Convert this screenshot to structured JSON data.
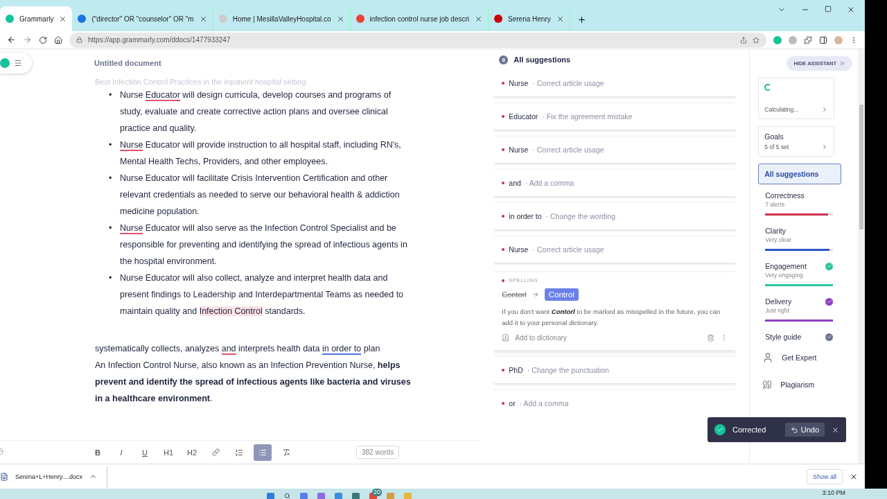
{
  "browser": {
    "tabs": [
      {
        "title": "Grammarly",
        "selected": true
      },
      {
        "title": "(\"director\" OR \"counselor\" OR \"m",
        "selected": false
      },
      {
        "title": "Home | MesillaValleyHospital.co",
        "selected": false
      },
      {
        "title": "infection control nurse job descri",
        "selected": false
      },
      {
        "title": "Serena Henry",
        "selected": false
      }
    ],
    "url": "https://app.grammarly.com/ddocs/1477933247"
  },
  "document": {
    "title": "Untitled document",
    "blocks": [
      {
        "kind": "faded",
        "segments": [
          {
            "text": "Best Infection Control Practices in the inpatient hospital setting.",
            "kind": "plain"
          }
        ]
      },
      {
        "kind": "bullet",
        "marker": "•",
        "segments": [
          {
            "text": "Nurse ",
            "kind": "plain"
          },
          {
            "text": "Educator",
            "kind": "error"
          },
          {
            "text": " will design curricula, develop courses and programs of study, evaluate and create corrective action plans and oversee clinical practice and quality.",
            "kind": "plain"
          }
        ]
      },
      {
        "kind": "bullet",
        "marker": "•",
        "segments": [
          {
            "text": "Nurse",
            "kind": "error"
          },
          {
            "text": " Educator will provide instruction to all hospital staff, including RN's, Mental Health Techs, Providers, and other employees.",
            "kind": "plain"
          }
        ]
      },
      {
        "kind": "bullet",
        "marker": "•",
        "segments": [
          {
            "text": "Nurse Educator will facilitate Crisis Intervention Certification and other relevant credentials as needed to serve our behavioral health & addiction medicine population.",
            "kind": "plain"
          }
        ]
      },
      {
        "kind": "bullet",
        "marker": "•",
        "segments": [
          {
            "text": "Nurse",
            "kind": "error"
          },
          {
            "text": " Educator will also serve as the Infection Control Specialist and be responsible for preventing and identifying the spread of infectious agents in the hospital environment.",
            "kind": "plain"
          }
        ]
      },
      {
        "kind": "bullet",
        "marker": "•",
        "segments": [
          {
            "text": "Nurse Educator will also collect, analyze and interpret health data and present findings to Leadership and Interdepartmental Teams as needed to maintain quality and ",
            "kind": "plain"
          },
          {
            "text": "Infection Control",
            "kind": "focus"
          },
          {
            "text": " standards.",
            "kind": "plain"
          }
        ]
      },
      {
        "kind": "paragraph",
        "segments": [
          {
            "text": "systematically collects, analyzes ",
            "kind": "plain"
          },
          {
            "text": "and",
            "kind": "error"
          },
          {
            "text": " interprets health data ",
            "kind": "plain"
          },
          {
            "text": "in order to",
            "kind": "clarity"
          },
          {
            "text": " plan",
            "kind": "plain"
          }
        ]
      },
      {
        "kind": "paragraph",
        "segments": [
          {
            "text": "An Infection Control Nurse, also known as an Infection Prevention Nurse, **helps prevent and identify the spread of infectious agents like bacteria and viruses in a healthcare environment**.",
            "kind": "plain"
          }
        ]
      }
    ],
    "toolbar": [
      {
        "kind": "bold",
        "label": "B",
        "selected": false
      },
      {
        "kind": "italic",
        "label": "I",
        "selected": false
      },
      {
        "kind": "underline",
        "label": "U",
        "selected": false
      },
      {
        "kind": "h1",
        "label": "H1",
        "selected": false
      },
      {
        "kind": "h2",
        "label": "H2",
        "selected": false
      },
      {
        "kind": "link",
        "selected": false
      },
      {
        "kind": "ordered",
        "selected": false
      },
      {
        "kind": "bullets",
        "selected": true
      },
      {
        "kind": "clear",
        "selected": false
      }
    ],
    "word_count": "382 words"
  },
  "suggestions": {
    "count": "8",
    "title": "All suggestions",
    "items": [
      {
        "kind": "short",
        "word": "Nurse",
        "hint": "· Correct article usage"
      },
      {
        "kind": "short",
        "word": "Educator",
        "hint": "· Fix the agreement mistake"
      },
      {
        "kind": "short",
        "word": "Nurse",
        "hint": "· Correct article usage"
      },
      {
        "kind": "short",
        "word": "and",
        "hint": "· Add a comma"
      },
      {
        "kind": "short",
        "word": "in order to",
        "hint": "· Change the wording"
      },
      {
        "kind": "short",
        "word": "Nurse",
        "hint": "· Correct article usage"
      },
      {
        "kind": "expanded",
        "category": "SPELLING",
        "wrong": "Contorl",
        "fix": "Control",
        "explanation": "If you don't want **Contorl** to be marked as misspelled in the future, you can add it to your personal dictionary.",
        "action": "Add to dictionary"
      },
      {
        "kind": "short",
        "word": "PhD",
        "hint": "· Change the punctuation"
      },
      {
        "kind": "short",
        "word": "or",
        "hint": "· Add a comma"
      }
    ]
  },
  "assistant": {
    "hide_button": "HIDE ASSISTANT",
    "score": "Calculating...",
    "goals": {
      "title": "Goals",
      "value": "5 of 5 set"
    },
    "nav": {
      "label": "All suggestions",
      "selected": true
    },
    "categories": [
      {
        "name": "Correctness",
        "status": "7 alerts",
        "level": 0.93,
        "color": "#d0324e",
        "checked": false
      },
      {
        "name": "Clarity",
        "status": "Very clear",
        "level": 0.95,
        "color": "#2a55c5",
        "checked": false
      },
      {
        "name": "Engagement",
        "status": "Very engaging",
        "level": 1,
        "color": "#2ec4a0",
        "checked": true
      },
      {
        "name": "Delivery",
        "status": "Just right",
        "level": 1,
        "color": "#8c3fc2",
        "checked": true
      }
    ],
    "style_guide": {
      "name": "Style guide",
      "checked": true
    },
    "expert": "Get Expert",
    "plagiarism": "Plagiarism"
  },
  "toast": {
    "message": "Corrected",
    "action": "Undo"
  },
  "downloads": {
    "file": "Serena+L+Henry....docx",
    "show_all": "Show all"
  },
  "taskbar": {
    "time": "3:10 PM",
    "badge": "20"
  }
}
